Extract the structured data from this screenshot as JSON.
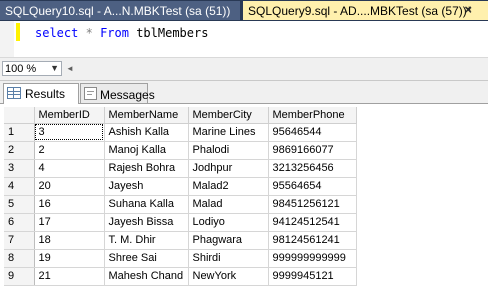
{
  "tabs": [
    {
      "label": "SQLQuery10.sql - A...N.MBKTest (sa (51))",
      "active": false
    },
    {
      "label": "SQLQuery9.sql - AD....MBKTest (sa (57))*",
      "active": true,
      "close": "×"
    }
  ],
  "editor": {
    "keyword1": "select",
    "star": "*",
    "keyword2": "From",
    "table": "tblMembers"
  },
  "zoom": {
    "value": "100 %",
    "arrow": "▼",
    "scroll": "◄"
  },
  "results_tabs": {
    "results_label": "Results",
    "messages_label": "Messages"
  },
  "grid": {
    "columns": [
      "MemberID",
      "MemberName",
      "MemberCity",
      "MemberPhone"
    ],
    "rows": [
      {
        "n": "1",
        "id": "3",
        "name": "Ashish Kalla",
        "city": "Marine Lines",
        "phone": "95646544"
      },
      {
        "n": "2",
        "id": "2",
        "name": "Manoj Kalla",
        "city": "Phalodi",
        "phone": "9869166077"
      },
      {
        "n": "3",
        "id": "4",
        "name": "Rajesh Bohra",
        "city": "Jodhpur",
        "phone": "3213256456"
      },
      {
        "n": "4",
        "id": "20",
        "name": "Jayesh",
        "city": "Malad2",
        "phone": "95564654"
      },
      {
        "n": "5",
        "id": "16",
        "name": "Suhana Kalla",
        "city": "Malad",
        "phone": "98451256121"
      },
      {
        "n": "6",
        "id": "17",
        "name": "Jayesh Bissa",
        "city": "Lodiyo",
        "phone": "94124512541"
      },
      {
        "n": "7",
        "id": "18",
        "name": "T. M. Dhir",
        "city": "Phagwara",
        "phone": "98124561241"
      },
      {
        "n": "8",
        "id": "19",
        "name": "Shree Sai",
        "city": "Shirdi",
        "phone": "999999999999"
      },
      {
        "n": "9",
        "id": "21",
        "name": "Mahesh Chand",
        "city": "NewYork",
        "phone": "9999945121"
      }
    ]
  }
}
